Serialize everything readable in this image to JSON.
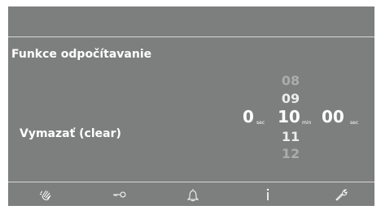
{
  "header": {
    "title": "Funkce odpočítavanie"
  },
  "clear": {
    "label": "Vymazať (clear)"
  },
  "timer": {
    "seconds_left": {
      "value": "0",
      "unit": "sec"
    },
    "minutes": {
      "value": "10",
      "unit": "min"
    },
    "seconds_right": {
      "value": "00",
      "unit": "sec"
    },
    "roller_values": [
      "08",
      "09",
      "11",
      "12"
    ]
  },
  "bottom_nav": {
    "icons": [
      "hand-wave-icon",
      "key-icon",
      "bell-icon",
      "info-icon",
      "wrench-icon"
    ]
  },
  "colors": {
    "background": "#7d7f7e",
    "text": "#ffffff",
    "rule": "#d6d7d6"
  }
}
